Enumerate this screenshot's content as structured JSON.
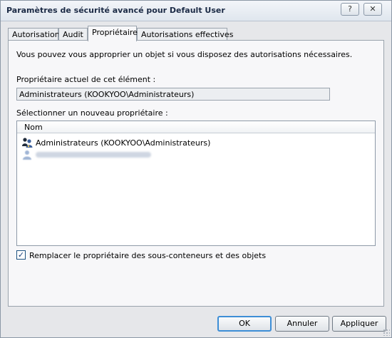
{
  "window": {
    "title": "Paramètres de sécurité avancé pour Default User",
    "help_glyph": "?",
    "close_glyph": "✕"
  },
  "tabs": [
    {
      "label": "Autorisations"
    },
    {
      "label": "Audit"
    },
    {
      "label": "Propriétaire",
      "active": true
    },
    {
      "label": "Autorisations effectives"
    }
  ],
  "owner_tab": {
    "intro": "Vous pouvez vous approprier un objet si vous disposez des autorisations nécessaires.",
    "current_owner_label": "Propriétaire actuel de cet élément :",
    "current_owner_value": "Administrateurs (KOOKYOO\\Administrateurs)",
    "new_owner_label": "Sélectionner un nouveau propriétaire :",
    "list": {
      "column_header": "Nom",
      "items": [
        {
          "name": "Administrateurs (KOOKYOO\\Administrateurs)",
          "icon": "user-group-icon"
        },
        {
          "name": "",
          "icon": "user-icon",
          "redacted": true
        }
      ]
    },
    "replace_checkbox": {
      "label": "Remplacer le propriétaire des sous-conteneurs et des objets",
      "checked": true
    }
  },
  "buttons": {
    "ok": "OK",
    "cancel": "Annuler",
    "apply": "Appliquer"
  }
}
